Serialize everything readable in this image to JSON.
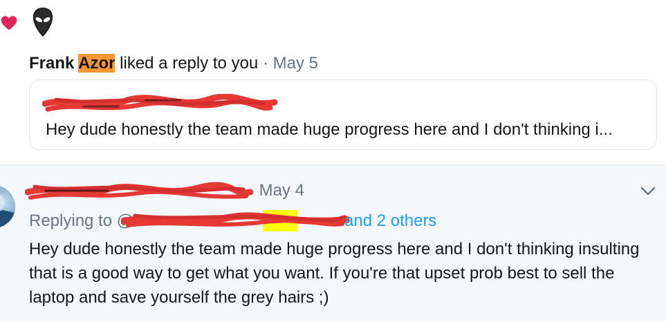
{
  "notification": {
    "liker_first_name": "Frank",
    "liker_last_name": "Azor",
    "action_text": "liked a reply to you",
    "separator": "·",
    "date": "May 5",
    "quoted_text": "Hey dude honestly the team made huge progress here and I don't thinking i..."
  },
  "reply": {
    "date_prefix": "·",
    "date": "May 4",
    "replying_prefix": "Replying to @",
    "replying_suffix_and": "and 2 others",
    "body": "Hey dude honestly the team made huge progress here and I don't thinking insulting that is a good way to get what you want. If you're that upset prob best to sell the laptop and save yourself the grey hairs ;)"
  },
  "icons": {
    "heart": "heart-icon",
    "avatar": "alien-avatar-icon",
    "chevron": "chevron-down-icon"
  },
  "colors": {
    "heart": "#e0245e",
    "highlight_orange": "#ff9632",
    "highlight_yellow": "#ffff00",
    "link": "#1da1f2",
    "muted": "#657786",
    "redaction": "#e53935"
  }
}
